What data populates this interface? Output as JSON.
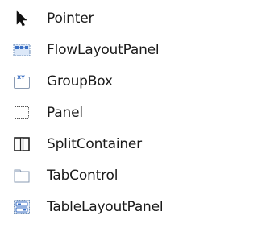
{
  "toolbox": {
    "items": [
      {
        "label": "Pointer",
        "icon": "pointer-icon"
      },
      {
        "label": "FlowLayoutPanel",
        "icon": "flowlayoutpanel-icon"
      },
      {
        "label": "GroupBox",
        "icon": "groupbox-icon",
        "icon_text": "XY"
      },
      {
        "label": "Panel",
        "icon": "panel-icon"
      },
      {
        "label": "SplitContainer",
        "icon": "splitcontainer-icon"
      },
      {
        "label": "TabControl",
        "icon": "tabcontrol-icon"
      },
      {
        "label": "TableLayoutPanel",
        "icon": "tablelayoutpanel-icon"
      }
    ]
  },
  "colors": {
    "icon_blue": "#3a6fc4",
    "icon_light_blue": "#dce8f8",
    "icon_border": "#6f8fb8",
    "text": "#1a1a1a"
  }
}
